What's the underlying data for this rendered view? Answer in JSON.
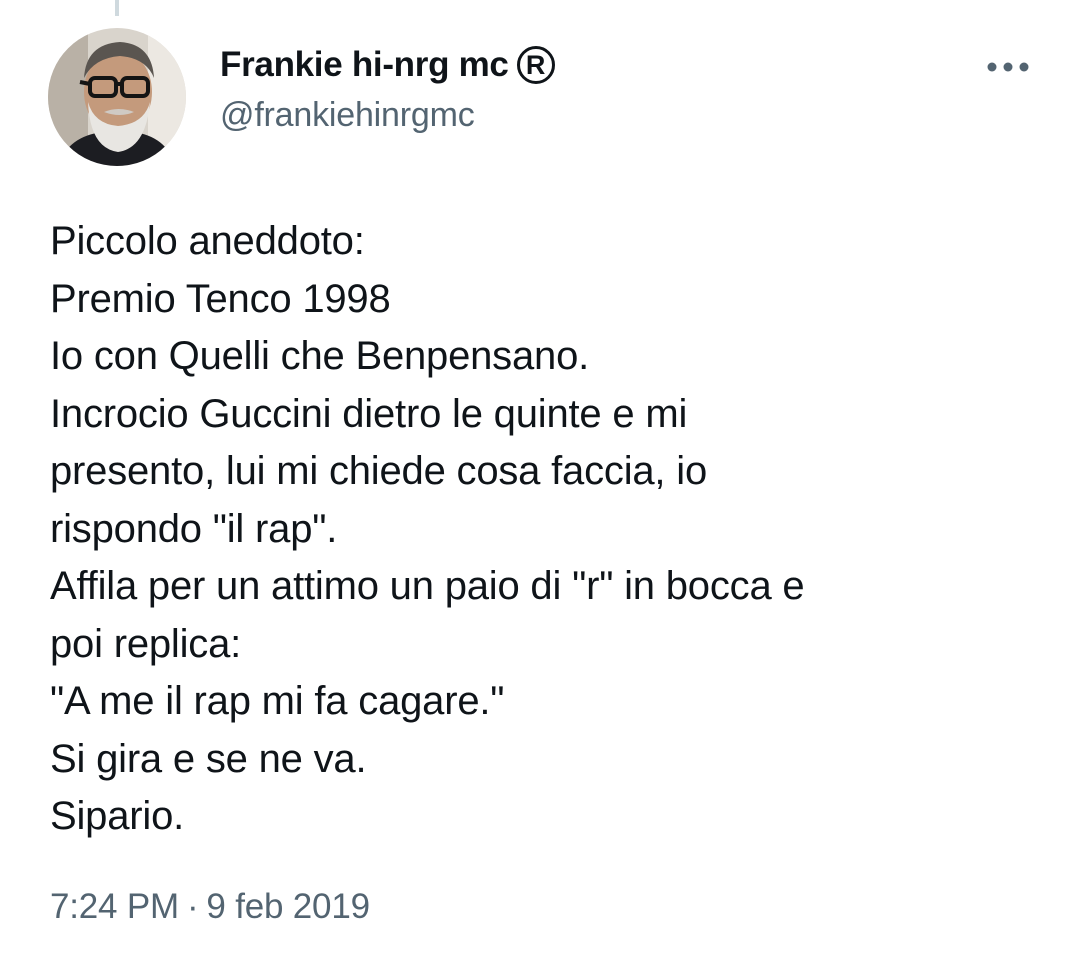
{
  "tweet": {
    "author": {
      "display_name": "Frankie hi-nrg mc",
      "badge_glyph": "R",
      "handle": "@frankiehinrgmc",
      "avatar_icon": "profile-photo"
    },
    "more_icon": "more-horizontal-icon",
    "text_lines": [
      "Piccolo aneddoto:",
      "Premio Tenco 1998",
      "Io con Quelli che Benpensano.",
      "Incrocio Guccini dietro le quinte e mi",
      "presento, lui mi chiede cosa faccia, io",
      "rispondo \"il rap\".",
      "Affila per un attimo un paio di \"r\" in bocca e",
      "poi replica:",
      "\"A me il rap mi fa cagare.\"",
      "Si gira e se ne va.",
      "Sipario."
    ],
    "time": "7:24 PM",
    "separator": "·",
    "date": "9 feb 2019"
  },
  "colors": {
    "primary_text": "#0f1419",
    "secondary_text": "#536471",
    "thread_line": "#cfd9de",
    "background": "#ffffff"
  }
}
